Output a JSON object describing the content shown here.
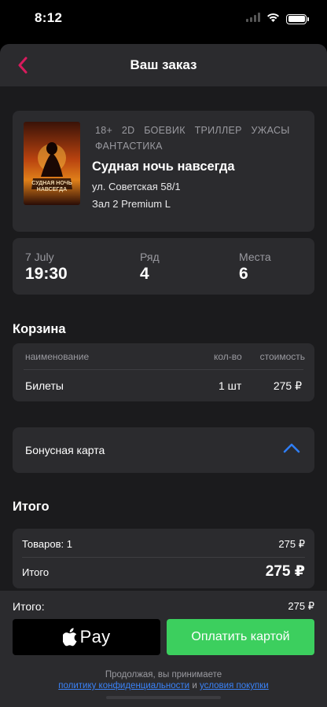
{
  "status_bar": {
    "time": "8:12"
  },
  "nav": {
    "title": "Ваш заказ"
  },
  "movie": {
    "genres": [
      "18+",
      "2D",
      "БОЕВИК",
      "ТРИЛЛЕР",
      "УЖАСЫ",
      "ФАНТАСТИКА"
    ],
    "title": "Судная ночь навсегда",
    "address": "ул. Советская 58/1",
    "hall": "Зал 2 Premium L",
    "poster_text": "СУДНАЯ НОЧЬ НАВСЕГДА"
  },
  "session": {
    "date_label": "7 July",
    "time_value": "19:30",
    "row_label": "Ряд",
    "row_value": "4",
    "seats_label": "Места",
    "seats_value": "6"
  },
  "cart": {
    "title": "Корзина",
    "headers": {
      "name": "наименование",
      "qty": "кол-во",
      "cost": "стоимость"
    },
    "rows": [
      {
        "name": "Билеты",
        "qty": "1 шт",
        "cost": "275 ₽"
      }
    ]
  },
  "bonus": {
    "label": "Бонусная карта",
    "accent": "#2f7ef6"
  },
  "total": {
    "title": "Итого",
    "items_label": "Товаров: 1",
    "items_value": "275 ₽",
    "sum_label": "Итого",
    "sum_value": "275 ₽"
  },
  "bottom": {
    "total_label": "Итого:",
    "total_value": "275 ₽",
    "apple_pay_label": "Pay",
    "card_pay_label": "Оплатить картой",
    "legal_text": "Продолжая, вы принимаете",
    "privacy_link": "политику конфиденциальности",
    "and_word": "и",
    "terms_link": "условия покупки"
  },
  "colors": {
    "accent_back": "#d81b5d",
    "pay_green": "#3ccf5e",
    "link": "#3a82f7"
  }
}
